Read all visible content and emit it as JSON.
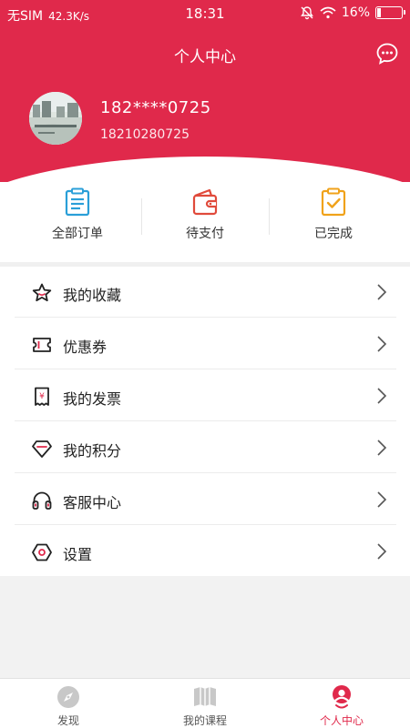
{
  "status_bar": {
    "carrier": "无SIM",
    "speed": "42.3K/s",
    "time": "18:31",
    "battery": "16%",
    "battery_level": 0.16
  },
  "header": {
    "title": "个人中心",
    "message_icon": "chat-bubble-icon"
  },
  "profile": {
    "name": "182****0725",
    "phone": "18210280725"
  },
  "orders": [
    {
      "label": "全部订单",
      "icon": "clipboard-icon",
      "color": "#2a9fd8"
    },
    {
      "label": "待支付",
      "icon": "wallet-icon",
      "color": "#e04a3b"
    },
    {
      "label": "已完成",
      "icon": "clipboard-check-icon",
      "color": "#f0a21a"
    }
  ],
  "menu": [
    {
      "label": "我的收藏",
      "icon": "star-icon"
    },
    {
      "label": "优惠券",
      "icon": "coupon-icon"
    },
    {
      "label": "我的发票",
      "icon": "invoice-icon"
    },
    {
      "label": "我的积分",
      "icon": "diamond-icon"
    },
    {
      "label": "客服中心",
      "icon": "headset-icon"
    },
    {
      "label": "设置",
      "icon": "settings-icon"
    }
  ],
  "tabbar": [
    {
      "label": "发现",
      "icon": "compass-icon",
      "active": false
    },
    {
      "label": "我的课程",
      "icon": "book-icon",
      "active": false
    },
    {
      "label": "个人中心",
      "icon": "person-icon",
      "active": true
    }
  ],
  "colors": {
    "brand": "#e0294b",
    "accent_red": "#e0294b"
  }
}
